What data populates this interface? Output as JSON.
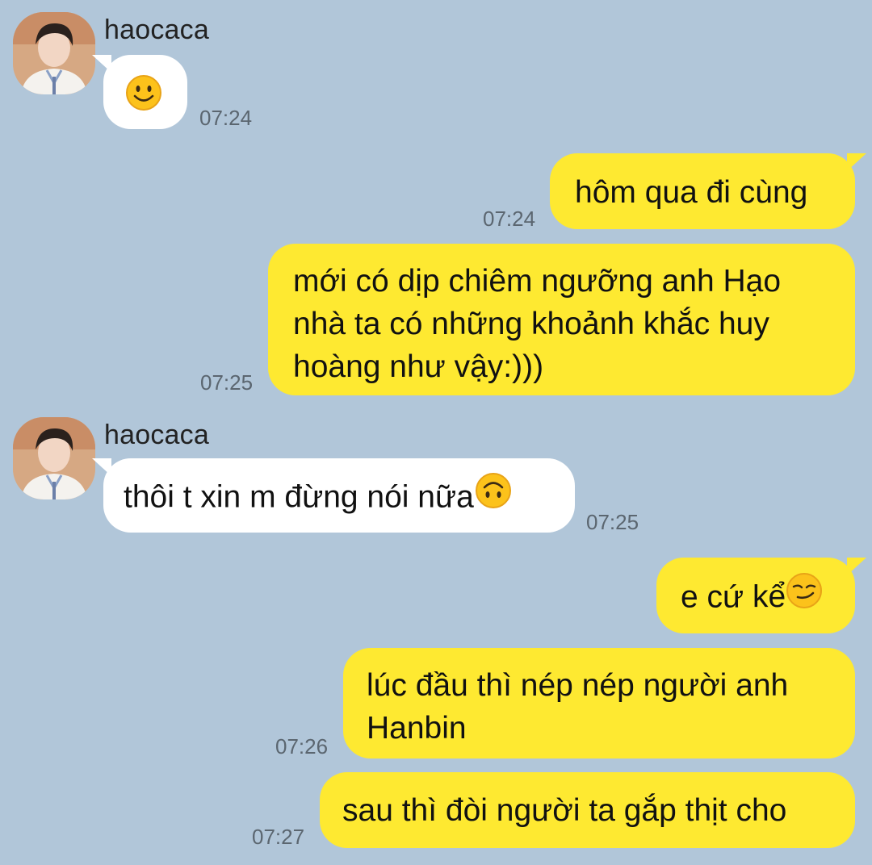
{
  "chat": {
    "messages": [
      {
        "sender": "haocaca",
        "text": "",
        "emoji": "smile-emoji",
        "time": "07:24",
        "direction": "in"
      },
      {
        "text": "hôm qua đi cùng",
        "time": "07:24",
        "direction": "out"
      },
      {
        "lines": [
          "mới có dịp chiêm ngưỡng anh Hạo",
          "nhà ta có những khoảnh khắc huy",
          "hoàng như vậy:)))"
        ],
        "time": "07:25",
        "direction": "out"
      },
      {
        "sender": "haocaca",
        "text": "thôi t xin m đừng nói nữa",
        "emoji": "upside-down-face-emoji",
        "time": "07:25",
        "direction": "in"
      },
      {
        "text": "e cứ kể",
        "emoji": "smirk-emoji",
        "time": "",
        "direction": "out"
      },
      {
        "lines": [
          "lúc đầu thì nép nép người anh",
          "Hanbin"
        ],
        "time": "07:26",
        "direction": "out"
      },
      {
        "text": "sau thì đòi người ta gắp thịt cho",
        "time": "07:27",
        "direction": "out"
      }
    ]
  },
  "colors": {
    "background": "#b1c6d9",
    "incoming_bubble": "#ffffff",
    "outgoing_bubble": "#fee931",
    "timestamp": "#5b6670"
  }
}
